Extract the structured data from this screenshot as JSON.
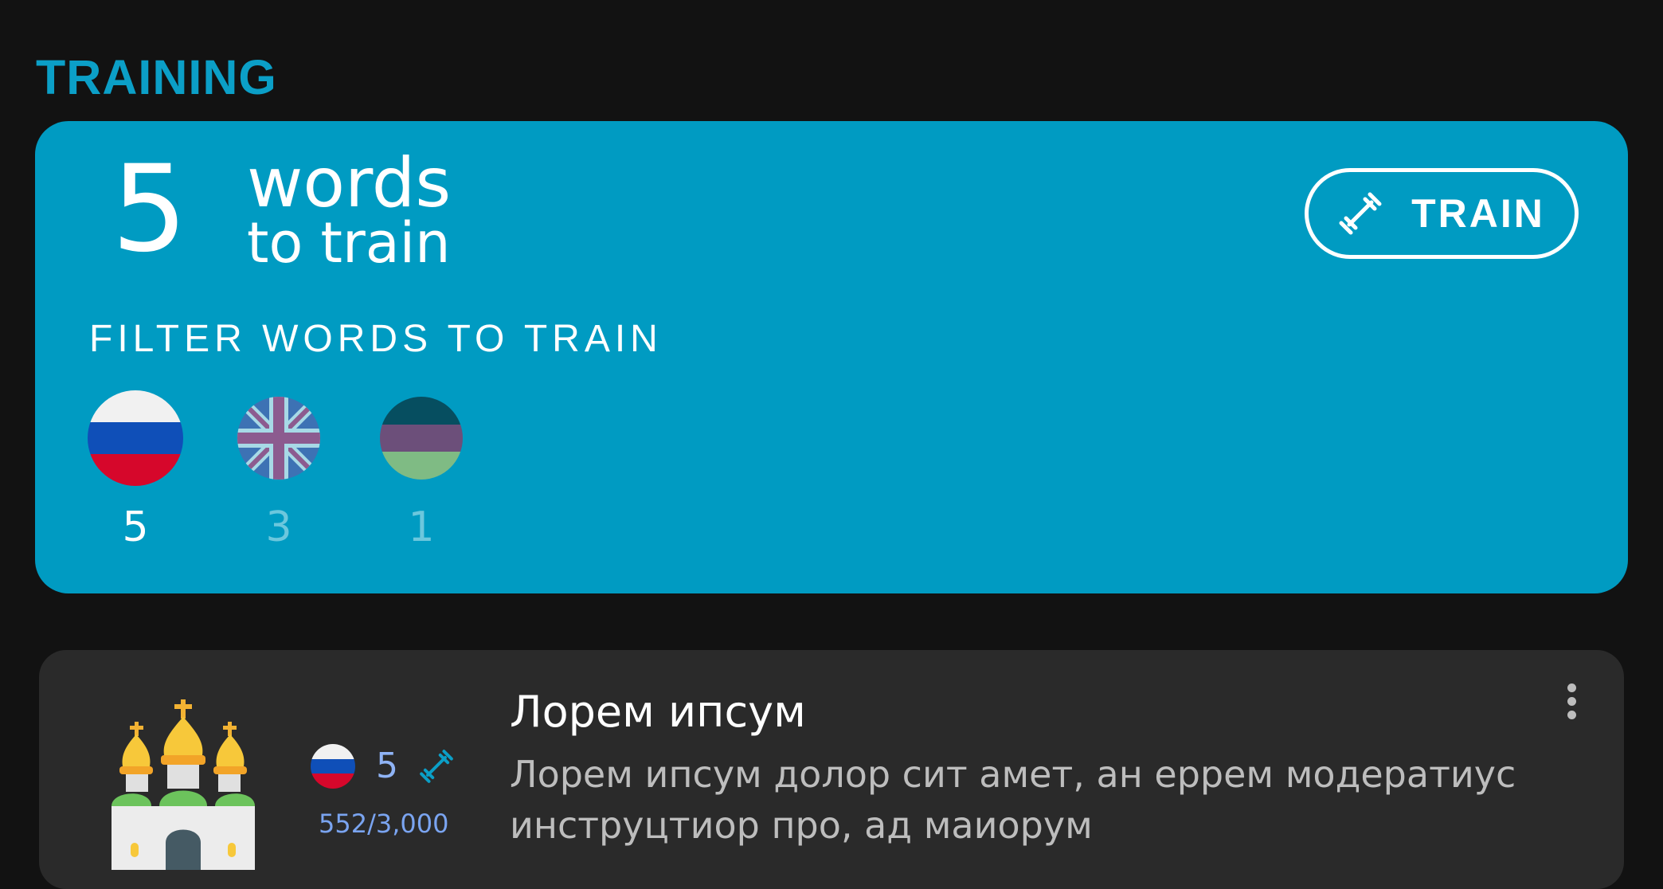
{
  "section": {
    "title": "TRAINING"
  },
  "summary": {
    "count": "5",
    "words_label": "words",
    "to_train_label": "to train",
    "train_button_label": "TRAIN"
  },
  "filter": {
    "title": "FILTER WORDS TO TRAIN",
    "languages": [
      {
        "name": "russian-flag",
        "count": "5",
        "selected": true
      },
      {
        "name": "uk-flag",
        "count": "3",
        "selected": false
      },
      {
        "name": "tricolor-flag",
        "count": "1",
        "selected": false
      }
    ]
  },
  "word_card": {
    "icon": "church-domes-icon",
    "flag": "russian-flag",
    "train_count": "5",
    "progress": "552/3,000",
    "title": "Лорем ипсум",
    "description": "Лорем ипсум долор сит амет, ан еррем модератиус инструцтиор про, ад маиорум"
  },
  "colors": {
    "background": "#121212",
    "accent": "#009bc2",
    "title": "#0b9fc7",
    "card": "#2a2a2a",
    "count_blue": "#8fb3f5"
  }
}
